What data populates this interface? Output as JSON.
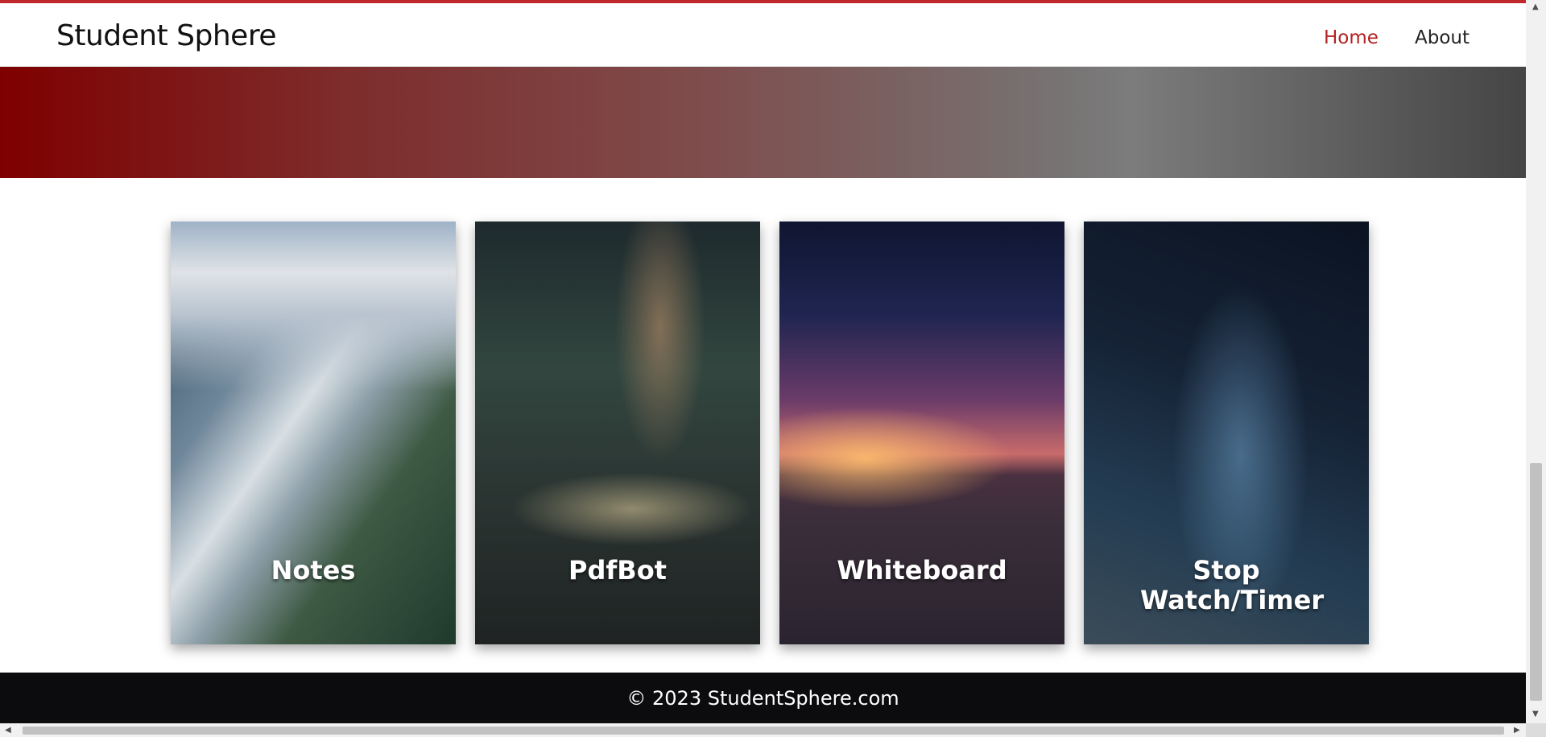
{
  "brand": "Student Sphere",
  "nav": {
    "home": "Home",
    "about": "About"
  },
  "cards": [
    {
      "label": "Notes",
      "icon": "mountain-image"
    },
    {
      "label": "PdfBot",
      "icon": "milky-way-palm-image"
    },
    {
      "label": "Whiteboard",
      "icon": "desert-sunset-image"
    },
    {
      "label": "Stop Watch/Timer",
      "icon": "starry-sky-image"
    }
  ],
  "footer": {
    "text": "© 2023 StudentSphere.com"
  },
  "colors": {
    "accent": "#b22222",
    "footer_bg": "#0c0c0f"
  }
}
